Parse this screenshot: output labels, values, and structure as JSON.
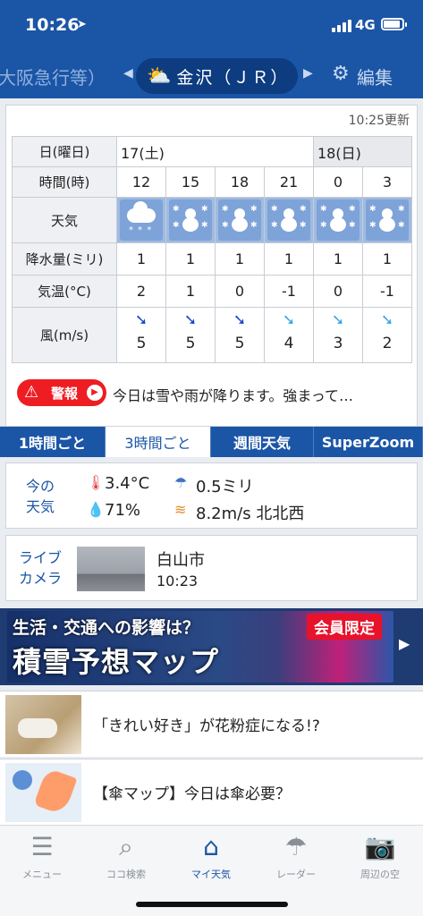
{
  "status": {
    "time": "10:26",
    "network": "4G"
  },
  "location": {
    "prev": "大阪急行等）",
    "name": "金沢（ＪＲ）",
    "edit": "編集",
    "prev_arrow": "◀",
    "next_arrow": "▶"
  },
  "forecast": {
    "updated": "10:25更新",
    "headers": {
      "date": "日(曜日)",
      "hour": "時間(時)",
      "weather": "天気",
      "precip": "降水量(ミリ)",
      "temp": "気温(°C)",
      "wind": "風(m/s)"
    },
    "day1": "17(土)",
    "day2": "18(日)",
    "hours": [
      "12",
      "15",
      "18",
      "21",
      "0",
      "3"
    ],
    "weather_icons": [
      "cloud-snow-icon",
      "snowman-icon",
      "snowman-icon",
      "snowman-icon",
      "snowman-icon",
      "snowman-icon"
    ],
    "precip": [
      "1",
      "1",
      "1",
      "1",
      "1",
      "1"
    ],
    "temp": [
      "2",
      "1",
      "0",
      "-1",
      "0",
      "-1"
    ],
    "wind_speed": [
      "5",
      "5",
      "5",
      "4",
      "3",
      "2"
    ],
    "wind_dir_glyph": "➘",
    "wind_colors": [
      "#1549c6",
      "#1549c6",
      "#1549c6",
      "#3aa6e6",
      "#3aa6e6",
      "#3aa6e6"
    ]
  },
  "warning": {
    "badge": "警報",
    "text": "今日は雪や雨が降ります。強まって…"
  },
  "tabs": [
    "1時間ごと",
    "3時間ごと",
    "週間天気",
    "SuperZoom"
  ],
  "current": {
    "label1": "今の",
    "label2": "天気",
    "temp": "3.4°C",
    "precip": "0.5ミリ",
    "humidity": "71%",
    "wind": "8.2m/s 北北西"
  },
  "livecam": {
    "label1": "ライブ",
    "label2": "カメラ",
    "city": "白山市",
    "time": "10:23"
  },
  "banner": {
    "line1": "生活・交通への影響は？",
    "line2": "積雪予想マップ",
    "badge": "会員限定"
  },
  "news": [
    {
      "text": "「きれい好き」が花粉症になる!?"
    },
    {
      "text": "【傘マップ】今日は傘必要？"
    }
  ],
  "nav": [
    {
      "label": "メニュー",
      "icon": "menu-icon"
    },
    {
      "label": "ココ検索",
      "icon": "search-icon"
    },
    {
      "label": "マイ天気",
      "icon": "home-icon"
    },
    {
      "label": "レーダー",
      "icon": "umbrella-icon"
    },
    {
      "label": "周辺の空",
      "icon": "camera-icon"
    }
  ]
}
